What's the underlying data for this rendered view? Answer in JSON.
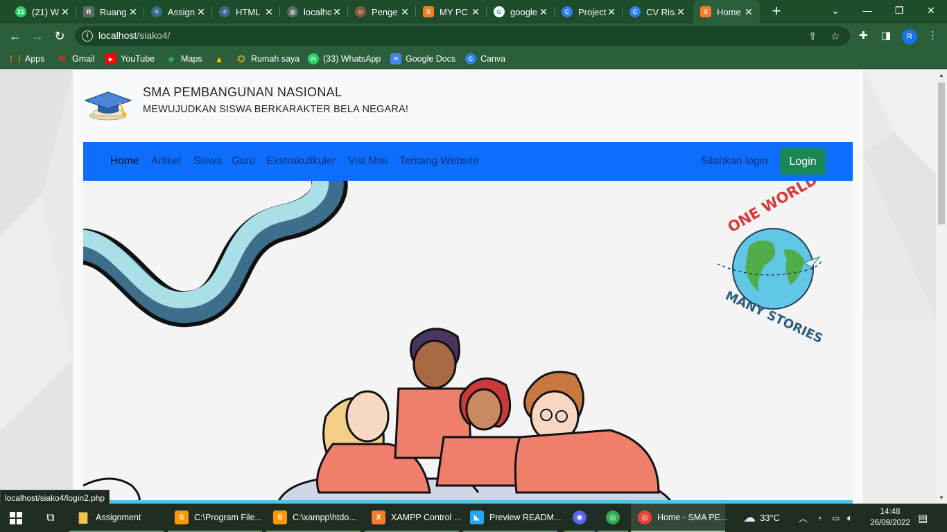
{
  "browser": {
    "tabs": [
      {
        "label": "(21) W",
        "icon": "whatsapp-icon",
        "color": "#25d366",
        "glyph": "21"
      },
      {
        "label": "Ruang",
        "icon": "classroom-icon",
        "color": "#5a6b60",
        "glyph": "R"
      },
      {
        "label": "Assign",
        "icon": "react-icon",
        "color": "#3a6b8a",
        "glyph": "⚛"
      },
      {
        "label": "HTML",
        "icon": "react-icon",
        "color": "#3a6b8a",
        "glyph": "⚛"
      },
      {
        "label": "localho",
        "icon": "globe-icon",
        "color": "#5f6a63",
        "glyph": "◍"
      },
      {
        "label": "Penge",
        "icon": "avatar-icon",
        "color": "#8a5a3c",
        "glyph": "☺"
      },
      {
        "label": "MY PC",
        "icon": "xampp-icon",
        "color": "#fb7a24",
        "glyph": "X"
      },
      {
        "label": "google",
        "icon": "google-icon",
        "color": "#ffffff",
        "glyph": "G"
      },
      {
        "label": "Project",
        "icon": "canva-icon",
        "color": "#2f80ed",
        "glyph": "C"
      },
      {
        "label": "CV Risa",
        "icon": "canva-icon",
        "color": "#2f80ed",
        "glyph": "C"
      },
      {
        "label": "Home",
        "icon": "xampp-icon",
        "color": "#fb7a24",
        "glyph": "X"
      }
    ],
    "active_tab_index": 10,
    "url_host": "localhost",
    "url_path": "/siako4/",
    "bookmarks": [
      {
        "label": "Apps",
        "icon": "apps-grid-icon",
        "color": "#e37400",
        "glyph": "⋮⋮"
      },
      {
        "label": "Gmail",
        "icon": "gmail-icon",
        "color": "#d93025",
        "glyph": "M"
      },
      {
        "label": "YouTube",
        "icon": "youtube-icon",
        "color": "#ff0000",
        "glyph": "▶"
      },
      {
        "label": "Maps",
        "icon": "maps-icon",
        "color": "#34a853",
        "glyph": "◆"
      },
      {
        "label": "",
        "icon": "drive-icon",
        "color": "#fbbc04",
        "glyph": "▲"
      },
      {
        "label": "Rumah saya",
        "icon": "emblem-icon",
        "color": "#c9a227",
        "glyph": "✪"
      },
      {
        "label": "(33) WhatsApp",
        "icon": "whatsapp-icon",
        "color": "#25d366",
        "glyph": "21"
      },
      {
        "label": "Google Docs",
        "icon": "docs-icon",
        "color": "#4285f4",
        "glyph": "≡"
      },
      {
        "label": "Canva",
        "icon": "canva-icon",
        "color": "#2f80ed",
        "glyph": "C"
      }
    ],
    "profile_initial": "R",
    "status_url": "localhost/siako4/login2.php"
  },
  "site": {
    "title": "SMA PEMBANGUNAN NASIONAL",
    "subtitle": "MEWUJUDKAN SISWA BERKARAKTER BELA NEGARA!",
    "nav": [
      "Home",
      "Artikel",
      "Siswa",
      "Guru",
      "Ekstrakulikuler",
      "Visi Misi",
      "Tentang Website"
    ],
    "nav_active": "Home",
    "login_prompt": "Silahkan login",
    "login_button": "Login",
    "hero_badge_top": "ONE WORLD",
    "hero_badge_bottom": "MANY STORIES"
  },
  "taskbar": {
    "items": [
      {
        "label": "Assignment",
        "icon": "folder-icon",
        "color": "#f2c14e",
        "glyph": "▇"
      },
      {
        "label": "C:\\Program File...",
        "icon": "sublime-icon",
        "color": "#ff9800",
        "glyph": "S"
      },
      {
        "label": "C:\\xampp\\htdo...",
        "icon": "sublime-icon",
        "color": "#ff9800",
        "glyph": "S"
      },
      {
        "label": "XAMPP Control ...",
        "icon": "xampp-icon",
        "color": "#fb7a24",
        "glyph": "X"
      },
      {
        "label": "Preview READM...",
        "icon": "vscode-icon",
        "color": "#23a9f2",
        "glyph": "◣"
      },
      {
        "label": "",
        "icon": "discord-icon",
        "color": "#5865f2",
        "glyph": "◉"
      },
      {
        "label": "",
        "icon": "chrome-icon",
        "color": "#34a853",
        "glyph": "◎"
      },
      {
        "label": "Home - SMA PE...",
        "icon": "chrome-icon",
        "color": "#ea4335",
        "glyph": "◎"
      }
    ],
    "weather": "33°C",
    "time": "14:48",
    "date": "26/09/2022"
  },
  "colors": {
    "frame": "#2b5e3a",
    "navbar": "#0d6efd",
    "login_button": "#198754"
  }
}
